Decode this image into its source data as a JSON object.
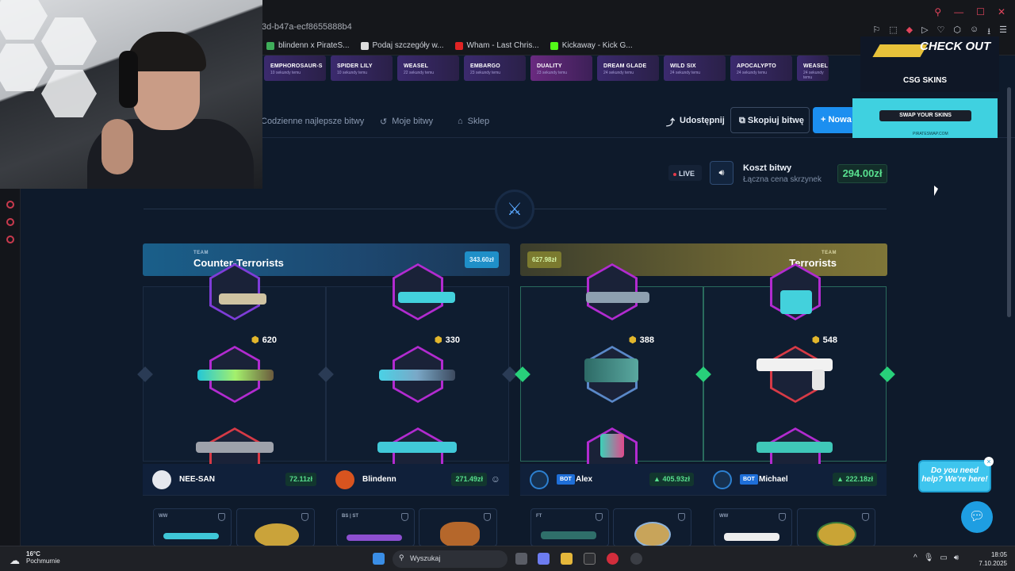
{
  "browser": {
    "url_fragment": "3d-b47a-ecf8655888b4",
    "bookmarks": [
      "blindenn x PirateS...",
      "Podaj szczegóły w...",
      "Wham - Last Chris...",
      "Kickaway - Kick G..."
    ]
  },
  "cases": [
    {
      "name": "EMPHOROSAUR-S",
      "sub": "10 sekundy temu"
    },
    {
      "name": "SPIDER LILY",
      "sub": "10 sekundy temu"
    },
    {
      "name": "WEASEL",
      "sub": "22 sekundy temu"
    },
    {
      "name": "EMBARGO",
      "sub": "23 sekundy temu"
    },
    {
      "name": "DUALITY",
      "sub": "23 sekundy temu"
    },
    {
      "name": "DREAM GLADE",
      "sub": "24 sekundy temu"
    },
    {
      "name": "WILD SIX",
      "sub": "24 sekundy temu"
    },
    {
      "name": "APOCALYPTO",
      "sub": "24 sekundy temu"
    },
    {
      "name": "WEASEL",
      "sub": "24 sekundy temu"
    }
  ],
  "ads": {
    "top_title": "CHECK OUT",
    "top_brand": "CSG SKINS",
    "swap_button": "SWAP YOUR SKINS",
    "swap_url": "PIRATESWAP.COM"
  },
  "nav": {
    "daily": "Codzienne najlepsze bitwy",
    "mine": "Moje bitwy",
    "shop": "Sklep",
    "share": "Udostępnij",
    "copy": "Skopiuj bitwę",
    "new": "Nowa"
  },
  "battle": {
    "live": "LIVE",
    "cost_title": "Koszt bitwy",
    "cost_sub": "Łączna cena skrzynek",
    "cost_value": "294.00zł"
  },
  "teams": {
    "ct": {
      "label": "TEAM",
      "name": "Counter-Terrorists",
      "amount": "343.60zł"
    },
    "t": {
      "label": "TEAM",
      "name": "Terrorists",
      "amount": "627.98zł"
    }
  },
  "slots": [
    {
      "price": "620"
    },
    {
      "price": "330"
    },
    {
      "price": "388"
    },
    {
      "price": "548"
    }
  ],
  "players": [
    {
      "name": "NEE-SAN",
      "value": "72.11zł",
      "bot": ""
    },
    {
      "name": "Blindenn",
      "value": "271.49zł",
      "bot": ""
    },
    {
      "name": "Alex",
      "value": "405.93zł",
      "bot": "BOT"
    },
    {
      "name": "Michael",
      "value": "222.18zł",
      "bot": "BOT"
    }
  ],
  "minis": [
    "WW",
    "",
    "BS | ST",
    "",
    "FT",
    "",
    "WW",
    ""
  ],
  "chat": {
    "bubble": "Do you need help? We're here!"
  },
  "taskbar": {
    "temp": "16°C",
    "weather": "Pochmurnie",
    "search": "Wyszukaj",
    "time": "18:05",
    "date": "7.10.2025"
  },
  "colors": {
    "bg": "#0e1a2b",
    "ct": "#1a5f8a",
    "t": "#7f7638",
    "accent": "#1c8ff0",
    "green": "#58e08f"
  }
}
